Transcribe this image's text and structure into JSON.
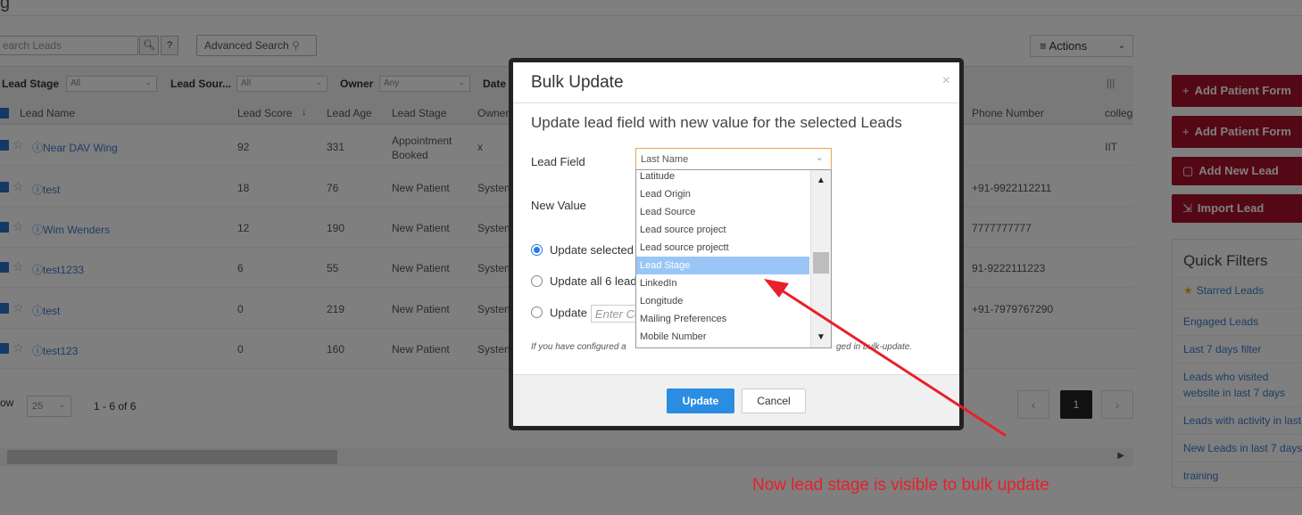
{
  "page": {
    "title_partial": "g",
    "search_placeholder": "earch Leads",
    "search_btn_icon": "search-icon",
    "help_label": "?",
    "advanced_search": "Advanced Search",
    "actions_label": "Actions"
  },
  "filters": {
    "lead_stage_label": "Lead Stage",
    "lead_stage_value": "All",
    "lead_source_label": "Lead Sour...",
    "lead_source_value": "All",
    "owner_label": "Owner",
    "owner_value": "Any",
    "date_label": "Date"
  },
  "table": {
    "headers": [
      "Lead Name",
      "Lead Score",
      "Lead Age",
      "Lead Stage",
      "Owner",
      "Phone Number",
      "colleg"
    ],
    "rows": [
      {
        "name": "Near DAV Wing",
        "score": "92",
        "age": "331",
        "stage": "Appointment Booked",
        "owner": "x",
        "phone": "",
        "college": "IIT"
      },
      {
        "name": "test",
        "score": "18",
        "age": "76",
        "stage": "New Patient",
        "owner": "Systen",
        "phone": "+91-9922112211",
        "college": ""
      },
      {
        "name": "Wim Wenders",
        "score": "12",
        "age": "190",
        "stage": "New Patient",
        "owner": "Systen",
        "phone": "7777777777",
        "college": ""
      },
      {
        "name": "test1233",
        "score": "6",
        "age": "55",
        "stage": "New Patient",
        "owner": "Systen",
        "phone": "91-9222111223",
        "college": ""
      },
      {
        "name": "test",
        "score": "0",
        "age": "219",
        "stage": "New Patient",
        "owner": "Systen",
        "phone": "+91-7979767290",
        "college": ""
      },
      {
        "name": "test123",
        "score": "0",
        "age": "160",
        "stage": "New Patient",
        "owner": "Systen",
        "phone": "",
        "college": ""
      }
    ]
  },
  "pager": {
    "show_label": "ow",
    "page_size": "25",
    "range": "1 - 6 of 6",
    "current_page": "1"
  },
  "sidebar": {
    "buttons": [
      "Add Patient Form",
      "Add Patient Form",
      "Add New Lead",
      "Import Lead"
    ],
    "quick_filters_title": "Quick Filters",
    "quick_filters": [
      "Starred Leads",
      "Engaged Leads",
      "Last 7 days filter",
      "Leads who visited website in last 7 days",
      "Leads with activity in last",
      "New Leads in last 7 days",
      "training"
    ]
  },
  "modal": {
    "title": "Bulk Update",
    "close": "×",
    "subtitle": "Update lead field with new value for the selected Leads",
    "lead_field_label": "Lead Field",
    "lead_field_value": "Last Name",
    "new_value_label": "New Value",
    "radio1": "Update selected",
    "radio2": "Update all 6 lead",
    "radio3": "Update",
    "radio3_placeholder": "Enter Co",
    "note_left": "If you have configured a",
    "note_right": "ged in bulk-update.",
    "update_btn": "Update",
    "cancel_btn": "Cancel"
  },
  "dropdown": {
    "options": [
      "Latitude",
      "Lead Origin",
      "Lead Source",
      "Lead source project",
      "Lead source projectt",
      "Lead Stage",
      "LinkedIn",
      "Longitude",
      "Mailing Preferences",
      "Mobile Number"
    ],
    "selected": "Lead Stage"
  },
  "annotation": {
    "text": "Now lead stage is visible to bulk update",
    "color": "#e8202a"
  }
}
